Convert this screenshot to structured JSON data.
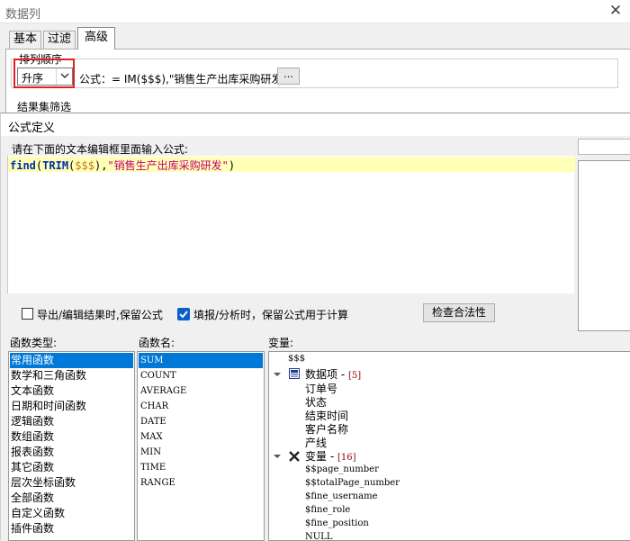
{
  "back_window": {
    "title": "数据列",
    "close": "✕",
    "tabs": [
      "基本",
      "过滤",
      "高级"
    ],
    "sort_section_label": "排列顺序",
    "sort_value": "升序",
    "formula_label": "公式：= IM($$$),\"销售生产出库采购研发\")",
    "formula_ellipsis": "...",
    "result_label": "结果集筛选"
  },
  "dialog": {
    "title": "公式定义",
    "hint": "请在下面的文本编辑框里面输入公式:",
    "formula": {
      "fn1": "find",
      "open1": "(",
      "fn2": "TRIM",
      "open2": "(",
      "var": "$$$",
      "close2": "),",
      "str": "\"销售生产出库采购研发\"",
      "close1": ")"
    },
    "export_checkbox": {
      "label": "导出/编辑结果时,保留公式",
      "checked": false
    },
    "fill_checkbox": {
      "label": "填报/分析时，保留公式用于计算",
      "checked": true
    },
    "check_button": "检查合法性",
    "func_type_label": "函数类型:",
    "func_name_label": "函数名:",
    "var_label": "变量:",
    "func_types": [
      "常用函数",
      "数学和三角函数",
      "文本函数",
      "日期和时间函数",
      "逻辑函数",
      "数组函数",
      "报表函数",
      "其它函数",
      "层次坐标函数",
      "全部函数",
      "自定义函数",
      "插件函数"
    ],
    "func_names": [
      "SUM",
      "COUNT",
      "AVERAGE",
      "CHAR",
      "DATE",
      "MAX",
      "MIN",
      "TIME",
      "RANGE"
    ],
    "vars": {
      "root": "$$$",
      "data_group": {
        "label": "数据项 - ",
        "count": "[5]",
        "items": [
          "订单号",
          "状态",
          "结束时间",
          "客户名称",
          "产线"
        ]
      },
      "var_group": {
        "label": "变量 - ",
        "count": "[16]",
        "items": [
          "$$page_number",
          "$$totalPage_number",
          "$fine_username",
          "$fine_role",
          "$fine_position",
          "NULL"
        ]
      }
    }
  }
}
